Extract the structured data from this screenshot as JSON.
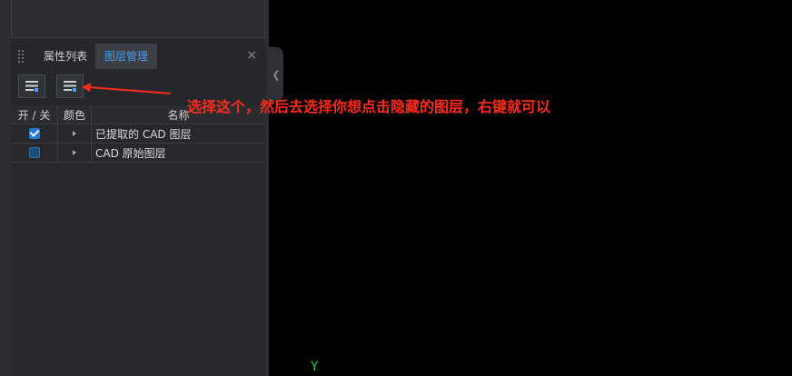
{
  "panel": {
    "tabs": [
      {
        "label": "属性列表"
      },
      {
        "label": "图层管理"
      }
    ],
    "close_symbol": "×"
  },
  "toolbar": {
    "buttons": [
      {
        "icon": "layer-list-icon"
      },
      {
        "icon": "layer-edit-icon"
      }
    ]
  },
  "layer_table": {
    "columns": [
      "开 / 关",
      "颜色",
      "名称"
    ],
    "rows": [
      {
        "visible": true,
        "name": "已提取的 CAD 图层"
      },
      {
        "visible": false,
        "name": "CAD 原始图层"
      }
    ]
  },
  "annotation": {
    "text": "选择这个，然后去选择你想点击隐藏的图层，右键就可以"
  },
  "viewport": {
    "axis_label": "Y"
  },
  "colors": {
    "accent_tab": "#4a9df0",
    "annotation": "#ff2a1a",
    "axis": "#22d34a",
    "checkbox_on": "#1e7ad6"
  }
}
